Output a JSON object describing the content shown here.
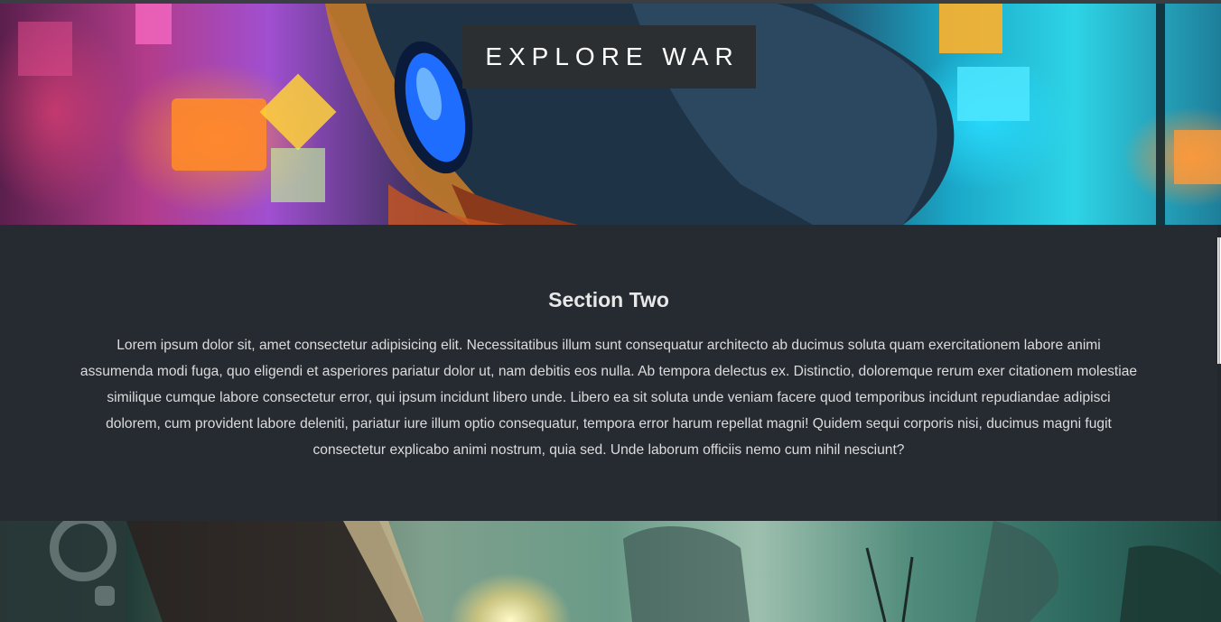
{
  "hero": {
    "banner_text": "EXPLORE WAR"
  },
  "section_two": {
    "title": "Section Two",
    "body": "Lorem ipsum dolor sit, amet consectetur adipisicing elit. Necessitatibus illum sunt consequatur architecto ab ducimus soluta quam exercitationem labore animi assumenda modi fuga, quo eligendi et asperiores pariatur dolor ut, nam debitis eos nulla. Ab tempora delectus ex. Distinctio, doloremque rerum exer citationem molestiae similique cumque labore consectetur error, qui ipsum incidunt libero unde. Libero ea sit soluta unde veniam facere quod temporibus incidunt repudiandae adipisci dolorem, cum provident labore deleniti, pariatur iure illum optio consequatur, tempora error harum repellat magni! Quidem sequi corporis nisi, ducimus magni fugit consectetur explicabo animi nostrum, quia sed. Unde laborum officiis nemo cum nihil nesciunt?"
  },
  "colors": {
    "banner_bg": "#2b2f31",
    "section_bg": "#262a31",
    "text": "#dcdcdc"
  }
}
